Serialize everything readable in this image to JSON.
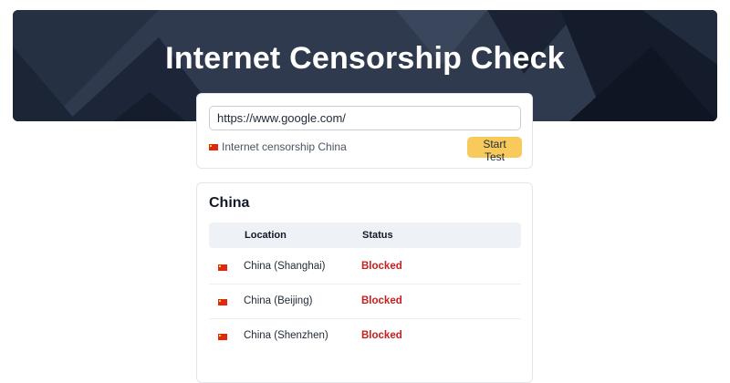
{
  "hero": {
    "title": "Internet Censorship Check"
  },
  "search": {
    "url_value": "https://www.google.com/",
    "subtitle": "Internet censorship China",
    "start_label": "Start Test"
  },
  "results": {
    "title": "China",
    "headers": {
      "location": "Location",
      "status": "Status"
    },
    "rows": [
      {
        "location": "China (Shanghai)",
        "status": "Blocked"
      },
      {
        "location": "China (Beijing)",
        "status": "Blocked"
      },
      {
        "location": "China (Shenzhen)",
        "status": "Blocked"
      }
    ]
  },
  "colors": {
    "hero_bg": "#2f3a4e",
    "accent_button": "#f8ca5b",
    "blocked": "#c81e1e",
    "flag": "#de2910"
  }
}
